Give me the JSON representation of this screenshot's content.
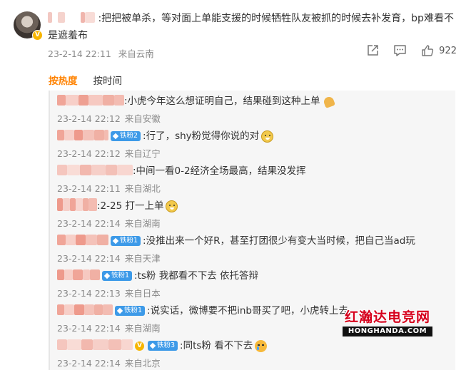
{
  "post": {
    "text": ":把把被单杀，等对面上单能支援的时候牺牲队友被抓的时候去补发育，bp难看不是遮羞布",
    "date": "23-2-14 22:11",
    "location": "来自云南",
    "likes": "922"
  },
  "tabs": [
    {
      "label": "按热度"
    },
    {
      "label": "按时间"
    }
  ],
  "replies": [
    {
      "text": ":小虎今年这么想证明自己，结果碰到这种上单",
      "badge": "",
      "emoji": "pray-emoji",
      "date": "23-2-14 22:12",
      "location": "来自安徽"
    },
    {
      "text": ":行了，shy粉觉得你说的对",
      "badge": "铁粉2",
      "emoji": "doge-emoji",
      "date": "23-2-14 22:12",
      "location": "来自辽宁"
    },
    {
      "text": ":中间一看0-2经济全场最高，结果没发挥",
      "badge": "",
      "emoji": "",
      "date": "23-2-14 22:11",
      "location": "来自湖北"
    },
    {
      "text": ":2-25 打一上单",
      "badge": "",
      "emoji": "doge-emoji",
      "date": "23-2-14 22:14",
      "location": "来自湖南"
    },
    {
      "text": ":没推出来一个好R，甚至打团很少有变大当时候，把自己当ad玩",
      "badge": "铁粉1",
      "emoji": "",
      "date": "23-2-14 22:14",
      "location": "来自天津"
    },
    {
      "text": ":ts粉 我都看不下去 依托答辩",
      "badge": "铁粉1",
      "emoji": "",
      "date": "23-2-14 22:13",
      "location": "来自日本"
    },
    {
      "text": ":说实话，微博要不把inb哥买了吧，小虎转上去",
      "badge": "铁粉1",
      "emoji": "",
      "date": "23-2-14 22:14",
      "location": "来自湖南"
    },
    {
      "text": ":同ts粉 看不下去",
      "badge": "铁粉3",
      "emoji": "cry-emoji",
      "date": "23-2-14 22:14",
      "location": "来自北京"
    }
  ],
  "watermark": {
    "cn": "红瀚达电竞网",
    "en": "HONGHANDA.COM"
  },
  "colors": {
    "accent": "#ff8200",
    "fan_badge": "#3d9ae8",
    "verified": "#f7b500",
    "meta_text": "#8a8a8a"
  }
}
